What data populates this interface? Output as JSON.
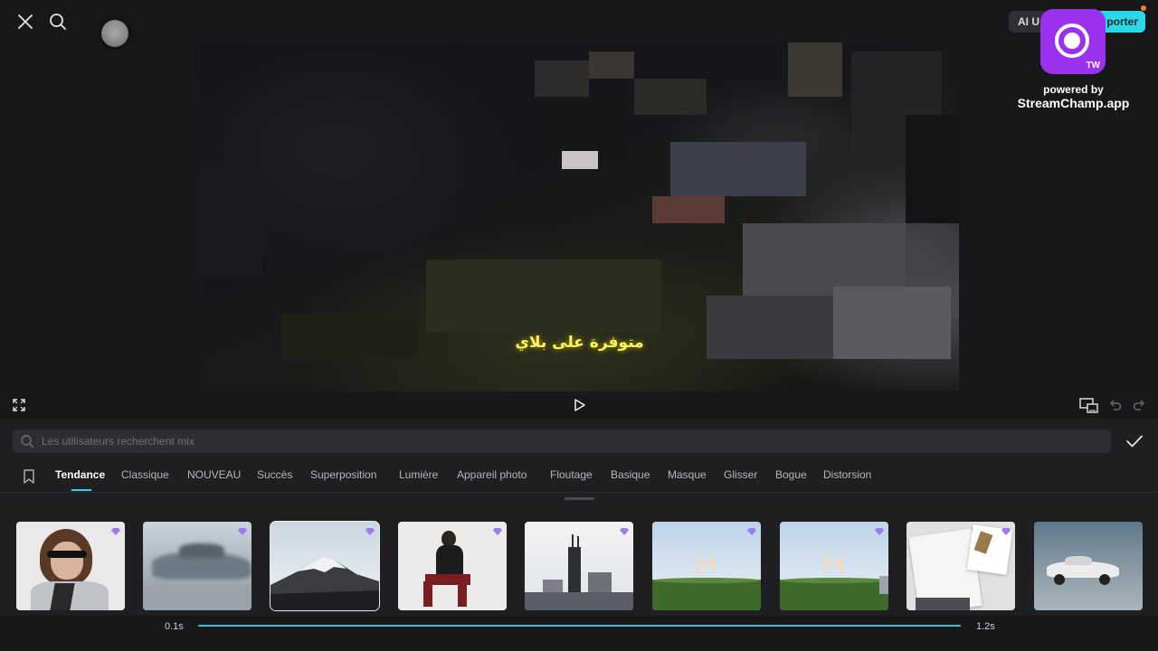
{
  "topbar": {
    "close_icon": "close-icon",
    "search_icon": "search-icon",
    "ai_button_label": "AI U",
    "export_button_label": "porter"
  },
  "watermark": {
    "badge_text": "TW",
    "powered_by": "powered by",
    "app_name": "StreamChamp.app",
    "brand_color": "#9b30ee"
  },
  "video": {
    "caption": "متوفرة على بلاي"
  },
  "controls": {
    "icons": [
      "fullscreen-icon",
      "play-icon",
      "crop-compare-icon",
      "undo-icon",
      "redo-icon"
    ]
  },
  "effects_panel": {
    "search_placeholder": "Les utilisateurs recherchent mix",
    "confirm_icon": "checkmark-icon",
    "bookmark_icon": "bookmark-icon",
    "tabs": [
      {
        "label": "Tendance",
        "active": true
      },
      {
        "label": "Classique"
      },
      {
        "label": "NOUVEAU"
      },
      {
        "label": "Succès"
      },
      {
        "label": "Superposition"
      },
      {
        "label": "Lumière"
      },
      {
        "label": "Appareil photo"
      },
      {
        "label": "Floutage"
      },
      {
        "label": "Basique"
      },
      {
        "label": "Masque"
      },
      {
        "label": "Glisser"
      },
      {
        "label": "Bogue"
      },
      {
        "label": "Distorsion"
      }
    ],
    "thumbnails": [
      {
        "subject": "woman-with-sunglasses",
        "selected": false,
        "pro": true
      },
      {
        "subject": "blurred-car",
        "selected": false,
        "pro": true
      },
      {
        "subject": "mountain-peak",
        "selected": true,
        "pro": true
      },
      {
        "subject": "woman-sitting-on-chair",
        "selected": false,
        "pro": true
      },
      {
        "subject": "city-tower",
        "selected": false,
        "pro": true
      },
      {
        "subject": "chair-on-grass",
        "selected": false,
        "pro": true
      },
      {
        "subject": "chair-on-grass",
        "selected": false,
        "pro": true
      },
      {
        "subject": "photo-clipped-on-paper",
        "selected": false,
        "pro": true
      },
      {
        "subject": "white-car-road",
        "selected": false,
        "pro": false
      }
    ]
  },
  "timeline": {
    "start_label": "0.1s",
    "end_label": "1.2s"
  },
  "colors": {
    "accent": "#2bd8e8",
    "caption": "#fff36a",
    "background": "#18181b"
  }
}
